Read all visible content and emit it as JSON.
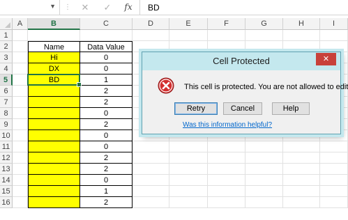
{
  "formula_bar": {
    "cancel_glyph": "✕",
    "enter_glyph": "✓",
    "fx_label": "fx",
    "value": "BD"
  },
  "columns": [
    "A",
    "B",
    "C",
    "D",
    "E",
    "F",
    "G",
    "H",
    "I"
  ],
  "rows": [
    "1",
    "2",
    "3",
    "4",
    "5",
    "6",
    "7",
    "8",
    "9",
    "10",
    "11",
    "12",
    "13",
    "14",
    "15",
    "16"
  ],
  "table": {
    "header_name": "Name",
    "header_value": "Data Value",
    "names": [
      "Hi",
      "DX",
      "BD",
      "",
      "",
      "",
      "",
      "",
      "",
      "",
      "",
      "",
      "",
      ""
    ],
    "values": [
      "0",
      "0",
      "1",
      "2",
      "2",
      "0",
      "2",
      "0",
      "0",
      "2",
      "2",
      "0",
      "1",
      "2"
    ]
  },
  "selection": {
    "column": "B",
    "row": "5"
  },
  "colors": {
    "highlight": "#ffff00",
    "accent": "#217346",
    "dialog_frame": "#c4e8ee",
    "close_button": "#c8413a",
    "error_icon": "#d32f2f",
    "link": "#0066cc"
  },
  "dialog": {
    "title": "Cell Protected",
    "close_glyph": "✕",
    "icon": "error-icon",
    "message": "This cell is protected. You are not allowed to edit.",
    "buttons": {
      "retry": "Retry",
      "cancel": "Cancel",
      "help": "Help"
    },
    "link": "Was this information helpful?"
  }
}
